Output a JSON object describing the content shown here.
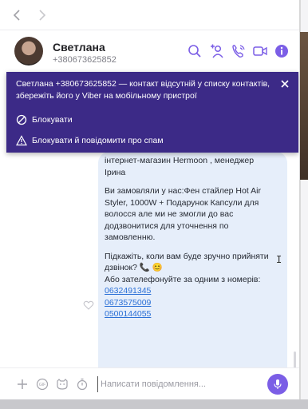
{
  "nav": {
    "back": "back",
    "forward": "forward"
  },
  "contact": {
    "name": "Светлана",
    "phone": "+380673625852"
  },
  "header_icons": [
    "search-icon",
    "add-contact-icon",
    "call-icon",
    "video-call-icon",
    "info-icon"
  ],
  "banner": {
    "message": "Светлана +380673625852 — контакт відсутній у списку контактів, збережіть його у Viber на мобільному пристрої",
    "block_label": "Блокувати",
    "block_report_label": "Блокувати й повідомити про спам"
  },
  "message": {
    "partial_line1": "інтернет-магазин Hermoon , менеджер",
    "partial_line2": "Ірина",
    "para1": [
      "Ви замовляли у нас:Фен стайлер Hot Air",
      "Styler, 1000W + Подарунок Капсули для",
      "волосся  але ми не змогли до вас",
      "додзвонитися для уточнення по",
      "замовленню."
    ],
    "para2_line1": "Підкажіть, коли вам буде зручно прийняти",
    "para2_line2": "дзвінок? 📞 😊",
    "para3_line1": "Або зателефонуйте за одним з номерів:",
    "phones": [
      "0632491345",
      "0673575009",
      "0500144055"
    ]
  },
  "composer": {
    "placeholder": "Написати повідомлення..."
  },
  "colors": {
    "accent": "#7b5ee6",
    "banner": "#3c2a87",
    "bubble": "#e6eefa",
    "link": "#2a6fd6"
  }
}
